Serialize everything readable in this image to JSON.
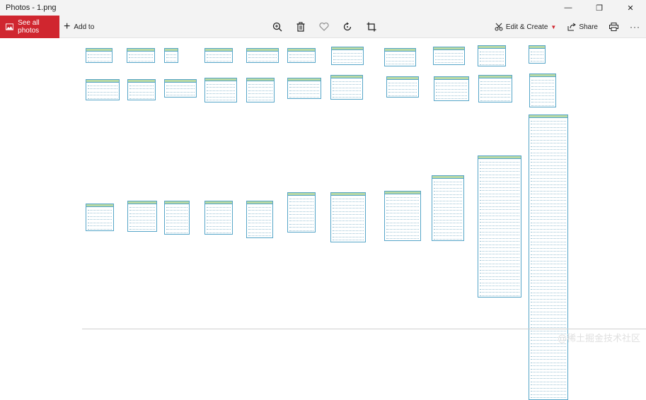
{
  "window": {
    "title": "Photos - 1.png",
    "minimize_label": "—",
    "maximize_label": "❐",
    "close_label": "✕"
  },
  "toolbar": {
    "see_all_label": "See all photos",
    "add_to_label": "Add to",
    "edit_create_label": "Edit & Create",
    "share_label": "Share"
  },
  "watermark": "@稀土掘金技术社区",
  "colors": {
    "accent": "#d0262f",
    "table_border": "#55a5c8",
    "table_header": "#b8d9a4"
  }
}
